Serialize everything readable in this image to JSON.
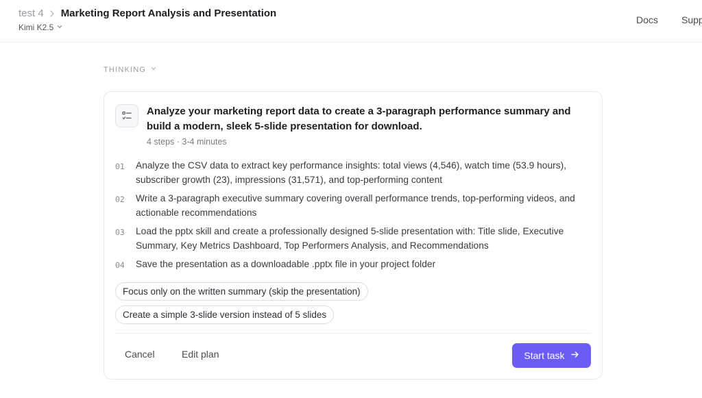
{
  "header": {
    "parent": "test 4",
    "title": "Marketing Report Analysis and Presentation",
    "model": "Kimi K2.5",
    "nav": [
      "Docs",
      "Supp"
    ]
  },
  "thinking": {
    "label": "THINKING"
  },
  "plan": {
    "title": "Analyze your marketing report data to create a 3-paragraph performance summary and build a modern, sleek 5-slide presentation for download.",
    "meta": "4 steps · 3-4 minutes",
    "steps": [
      {
        "num": "01",
        "text": "Analyze the CSV data to extract key performance insights: total views (4,546), watch time (53.9 hours), subscriber growth (23), impressions (31,571), and top-performing content"
      },
      {
        "num": "02",
        "text": "Write a 3-paragraph executive summary covering overall performance trends, top-performing videos, and actionable recommendations"
      },
      {
        "num": "03",
        "text": "Load the pptx skill and create a professionally designed 5-slide presentation with: Title slide, Executive Summary, Key Metrics Dashboard, Top Performers Analysis, and Recommendations"
      },
      {
        "num": "04",
        "text": "Save the presentation as a downloadable .pptx file in your project folder"
      }
    ],
    "alternatives": [
      "Focus only on the written summary (skip the presentation)",
      "Create a simple 3-slide version instead of 5 slides"
    ],
    "cancel_label": "Cancel",
    "edit_label": "Edit plan",
    "start_label": "Start task"
  },
  "colors": {
    "accent": "#6b5cf6",
    "border": "#e7e7ec",
    "muted_text": "#9a9aa2"
  }
}
